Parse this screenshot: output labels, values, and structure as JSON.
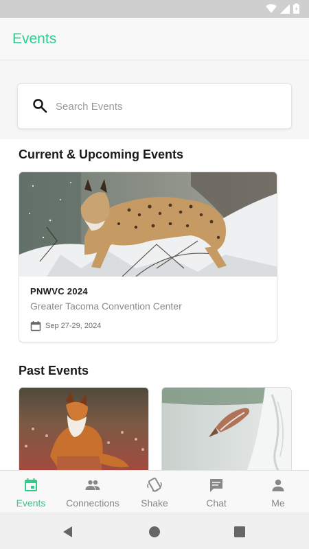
{
  "app": {
    "title": "Events"
  },
  "search": {
    "placeholder": "Search Events",
    "value": ""
  },
  "sections": {
    "current_title": "Current & Upcoming Events",
    "past_title": "Past Events"
  },
  "current_event": {
    "name": "PNWVC 2024",
    "venue": "Greater Tacoma Convention Center",
    "date": "Sep 27-29, 2024",
    "icon": "calendar-icon"
  },
  "past_events": [
    {
      "image": "fox-photo"
    },
    {
      "image": "salmon-waterfall-photo"
    }
  ],
  "bottom_nav": {
    "items": [
      {
        "label": "Events",
        "icon": "calendar-icon",
        "active": true
      },
      {
        "label": "Connections",
        "icon": "people-icon",
        "active": false
      },
      {
        "label": "Shake",
        "icon": "shake-phone-icon",
        "active": false
      },
      {
        "label": "Chat",
        "icon": "chat-bubble-icon",
        "active": false
      },
      {
        "label": "Me",
        "icon": "person-icon",
        "active": false
      }
    ]
  },
  "colors": {
    "accent": "#2ecc8a",
    "inactive": "#888888",
    "status_bar": "#cfcfcf"
  }
}
